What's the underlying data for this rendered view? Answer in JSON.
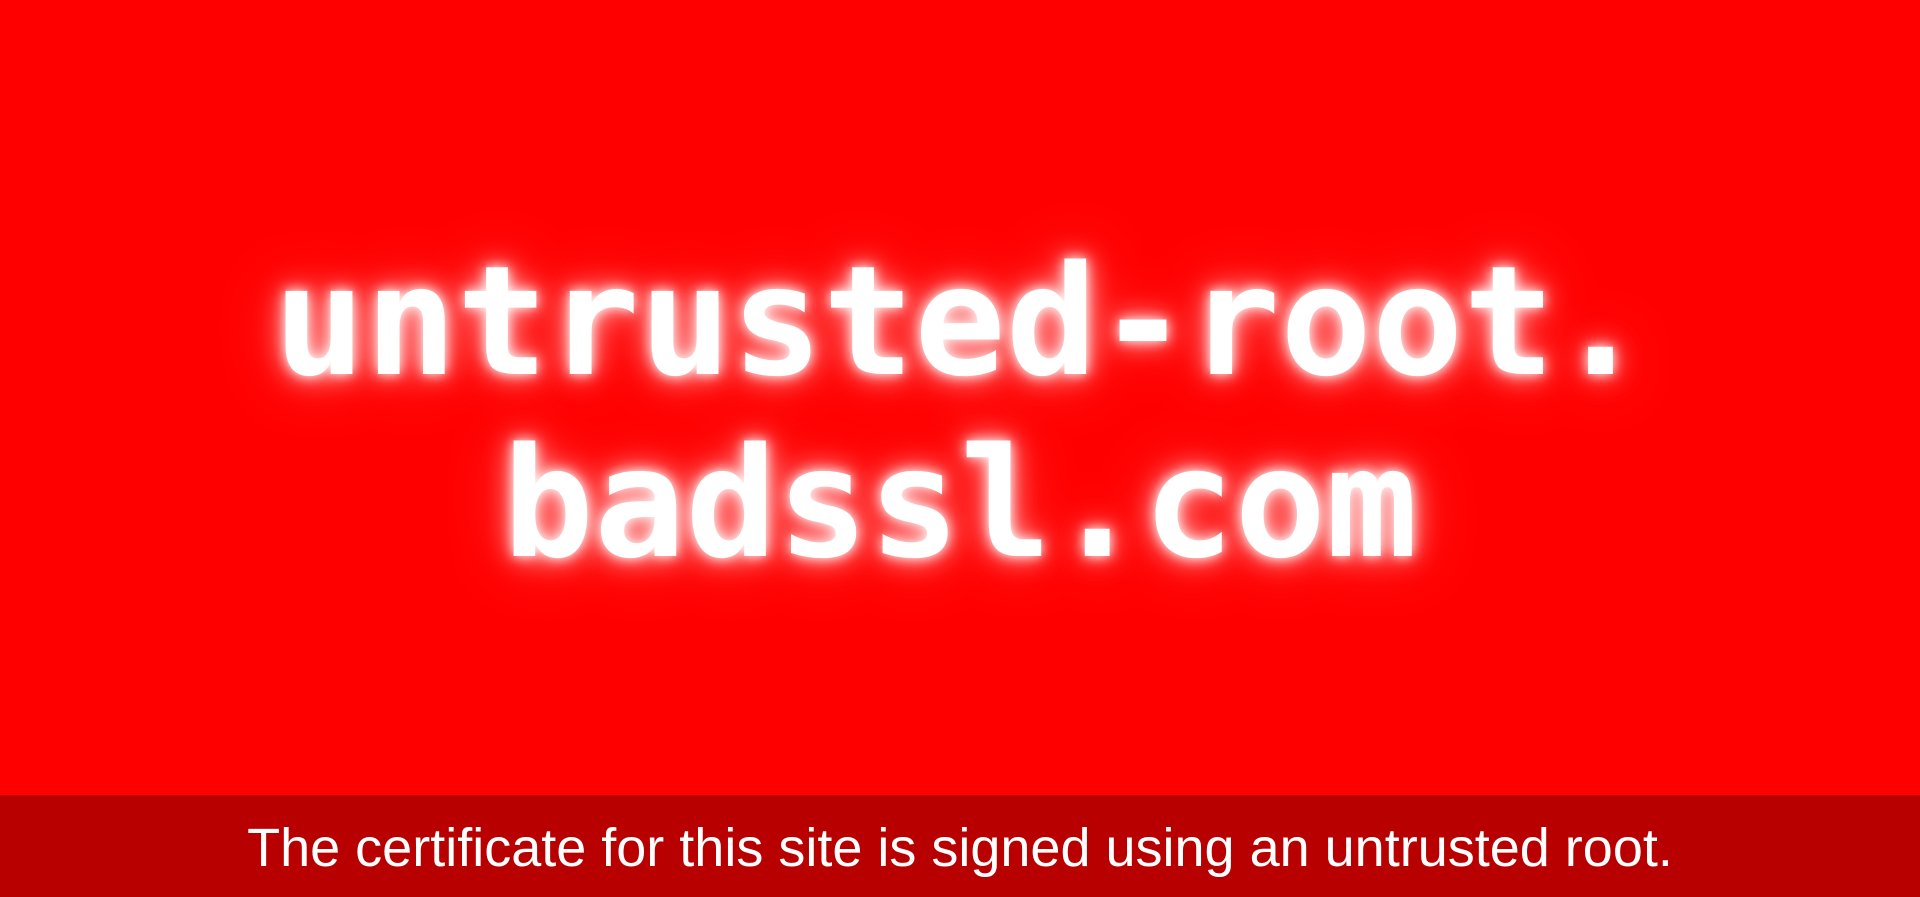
{
  "domain": {
    "line1": "untrusted-root.",
    "line2": "badssl.com"
  },
  "footer": {
    "text": "The certificate for this site is signed using an untrusted root."
  },
  "colors": {
    "background": "#ff0000",
    "footer_background": "#b90000",
    "text": "#ffffff"
  }
}
